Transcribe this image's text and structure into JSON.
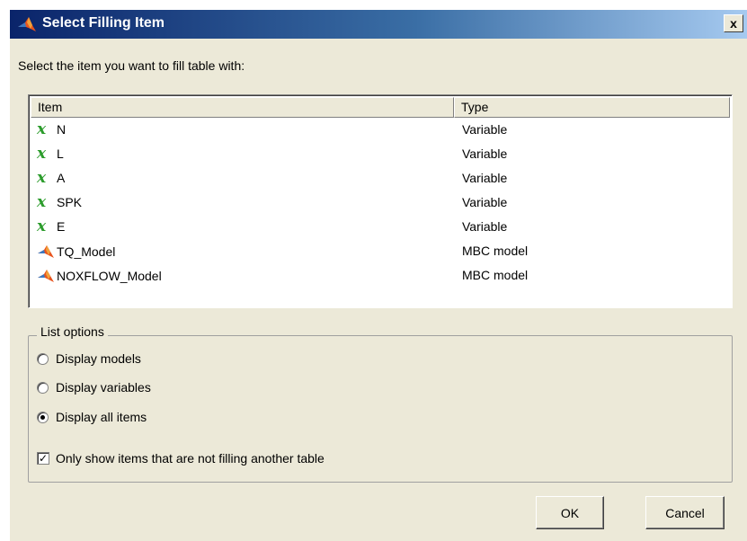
{
  "window": {
    "title": "Select Filling Item",
    "close_label": "x"
  },
  "prompt": "Select the item you want to fill table with:",
  "list": {
    "columns": [
      "Item",
      "Type"
    ],
    "rows": [
      {
        "icon": "variable-icon",
        "name": "N",
        "type": "Variable"
      },
      {
        "icon": "variable-icon",
        "name": "L",
        "type": "Variable"
      },
      {
        "icon": "variable-icon",
        "name": "A",
        "type": "Variable"
      },
      {
        "icon": "variable-icon",
        "name": "SPK",
        "type": "Variable"
      },
      {
        "icon": "variable-icon",
        "name": "E",
        "type": "Variable"
      },
      {
        "icon": "matlab-model-icon",
        "name": "TQ_Model",
        "type": "MBC model"
      },
      {
        "icon": "matlab-model-icon",
        "name": "NOXFLOW_Model",
        "type": "MBC model"
      }
    ],
    "variable_glyph": "x"
  },
  "options": {
    "legend": "List options",
    "radios": [
      {
        "label": "Display models",
        "selected": false
      },
      {
        "label": "Display variables",
        "selected": false
      },
      {
        "label": "Display all items",
        "selected": true
      }
    ],
    "checkbox": {
      "label": "Only show items that are not filling another table",
      "checked": true,
      "mark": "✓"
    }
  },
  "buttons": {
    "ok": "OK",
    "cancel": "Cancel"
  },
  "colors": {
    "titlebar_start": "#0a246a",
    "titlebar_end": "#a6caf0",
    "dialog_bg": "#ece9d8",
    "variable_icon": "#2c9c2c"
  }
}
